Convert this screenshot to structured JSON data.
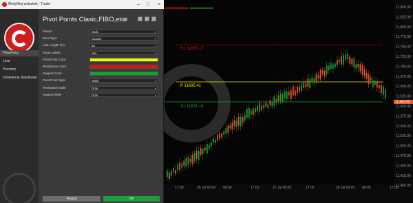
{
  "window": {
    "title": "Modyfikuj wskaźnik - Trader"
  },
  "sidebar": {
    "items": [
      {
        "label": "Parametry"
      },
      {
        "label": "Linie"
      },
      {
        "label": "Poziomy"
      },
      {
        "label": "Ustawienia dodatkowe"
      }
    ]
  },
  "indicator": {
    "title": "Pivot Points Clasic,FIBO,etc"
  },
  "settings": [
    {
      "label": "Period",
      "value": "Daily",
      "type": "select"
    },
    {
      "label": "Pivot Type",
      "value": "Classic",
      "type": "select"
    },
    {
      "label": "Line Length (%)",
      "value": "50",
      "type": "select"
    },
    {
      "label": "Show Labels",
      "value": "Yes",
      "type": "select"
    },
    {
      "label": "Pivot Point Color",
      "value": "",
      "type": "color",
      "color": "#f5f500"
    },
    {
      "label": "Resistance Color",
      "value": "",
      "type": "color",
      "color": "#e01010"
    },
    {
      "label": "Support Color",
      "value": "",
      "type": "color",
      "color": "#12a52a"
    },
    {
      "label": "Pivot Point Style",
      "value": "Solid",
      "type": "select"
    },
    {
      "label": "Resistance Style",
      "value": "Dots",
      "type": "select"
    },
    {
      "label": "Support Style",
      "value": "Dots",
      "type": "select"
    }
  ],
  "buttons": {
    "cancel": "Anuluj",
    "ok": "OK"
  },
  "chart": {
    "price_labels": [
      "11,850.00",
      "11,825.00",
      "11,800.00",
      "11,775.00",
      "11,750.00",
      "11,725.00",
      "11,700.00",
      "11,675.00",
      "11,650.00",
      "11,625.00",
      "11,600.00",
      "11,575.00",
      "11,550.00",
      "11,525.00",
      "11,500.00",
      "11,475.00",
      "11,450.00",
      "11,425.00",
      "11,400.00"
    ],
    "current_price": "11,660.00",
    "time_labels": [
      "17:00",
      "26 Jul 00:00",
      "08:00",
      "17:00",
      "27 Jul 00:00",
      "17:00",
      "28 Jul 00:00",
      "08:00",
      "17:00"
    ],
    "lines": {
      "resistance_label": "R1 11805.17",
      "pivot_label": "P 11695.41",
      "support_label": "S1 11631.18"
    },
    "colors": {
      "up": "#1f9a3c",
      "down": "#e0582e",
      "pivot": "#f5f500",
      "resistance": "#e01010",
      "support": "#12a52a"
    }
  }
}
